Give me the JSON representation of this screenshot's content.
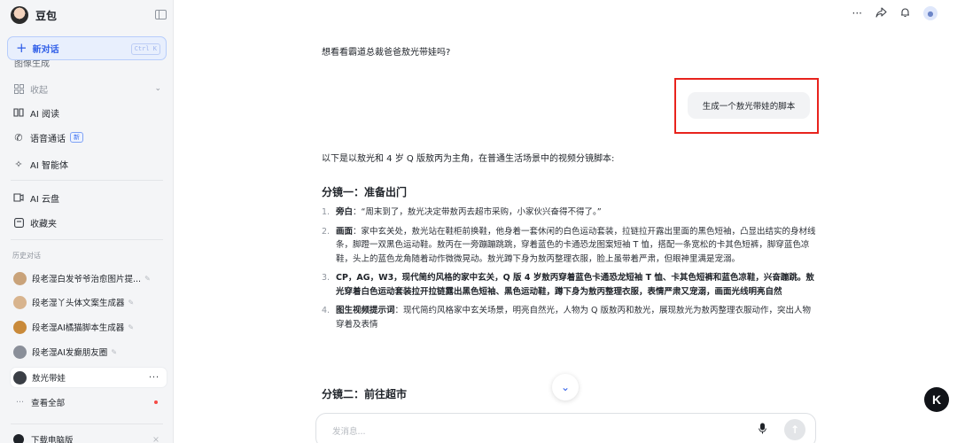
{
  "sidebar": {
    "app_name": "豆包",
    "new_chat": {
      "label": "新对话",
      "shortcut": "Ctrl K"
    },
    "cut_item": "图像生成",
    "nav": [
      {
        "label": "收起",
        "icon": "grid-icon"
      },
      {
        "label": "AI 阅读",
        "icon": "read-icon"
      },
      {
        "label": "语音通话",
        "icon": "phone-icon",
        "badge": "新"
      },
      {
        "label": "AI 智能体",
        "icon": "agent-icon"
      },
      {
        "label": "AI 云盘",
        "icon": "cloud-drive-icon"
      },
      {
        "label": "收藏夹",
        "icon": "favorites-icon"
      }
    ],
    "history_label": "历史对话",
    "history": [
      {
        "title": "段老湿白发爷爷治愈图片提...",
        "color": "#c9a37a"
      },
      {
        "title": "段老湿丫头体文案生成器",
        "color": "#d8b48e"
      },
      {
        "title": "段老湿AI橘猫脚本生成器",
        "color": "#c98a3a"
      },
      {
        "title": "段老湿AI发癫朋友圈",
        "color": "#8a8f99"
      },
      {
        "title": "敖光带娃",
        "color": "#3b3f46"
      }
    ],
    "view_all": "查看全部",
    "download": "下载电脑版"
  },
  "chat": {
    "first_line": "想看看霸道总裁爸爸敖光带娃吗?",
    "user_message": "生成一个敖光带娃的脚本",
    "intro": "以下是以敖光和 4 岁 Q 版敖丙为主角，在普通生活场景中的视频分镜脚本:",
    "section1_title": "分镜一：准备出门",
    "items": [
      {
        "num": "1.",
        "label": "旁白",
        "text": "：“周末到了，敖光决定带敖丙去超市采购，小家伙兴奋得不得了。”"
      },
      {
        "num": "2.",
        "label": "画面",
        "text": "：家中玄关处，敖光站在鞋柜前换鞋，他身着一套休闲的白色运动套装，拉链拉开露出里面的黑色短袖，凸显出结实的身材线条，脚蹬一双黑色运动鞋。敖丙在一旁蹦蹦跳跳，穿着蓝色的卡通恐龙图案短袖 T 恤，搭配一条宽松的卡其色短裤，脚穿蓝色凉鞋，头上的蓝色龙角随着动作微微晃动。敖光蹲下身为敖丙整理衣服，脸上虽带着严肃，但眼神里满是宠溺。"
      },
      {
        "num": "3.",
        "label": "",
        "text": "CP，AG，W3，现代简约风格的家中玄关，Q 版 4 岁敖丙穿着蓝色卡通恐龙短袖 T 恤、卡其色短裤和蓝色凉鞋，兴奋蹦跳。敖光穿着白色运动套装拉开拉链露出黑色短袖、黑色运动鞋，蹲下身为敖丙整理衣服，表情严肃又宠溺，画面光线明亮自然"
      },
      {
        "num": "4.",
        "label": "图生视频提示词",
        "text": "：现代简约风格家中玄关场景，明亮自然光，人物为 Q 版敖丙和敖光，展现敖光为敖丙整理衣服动作，突出人物穿着及表情"
      }
    ],
    "section2_title": "分镜二：前往超市",
    "input_placeholder": "发消息..."
  },
  "colors": {
    "accent": "#2f5ee8",
    "highlight_box": "#e8231d"
  }
}
